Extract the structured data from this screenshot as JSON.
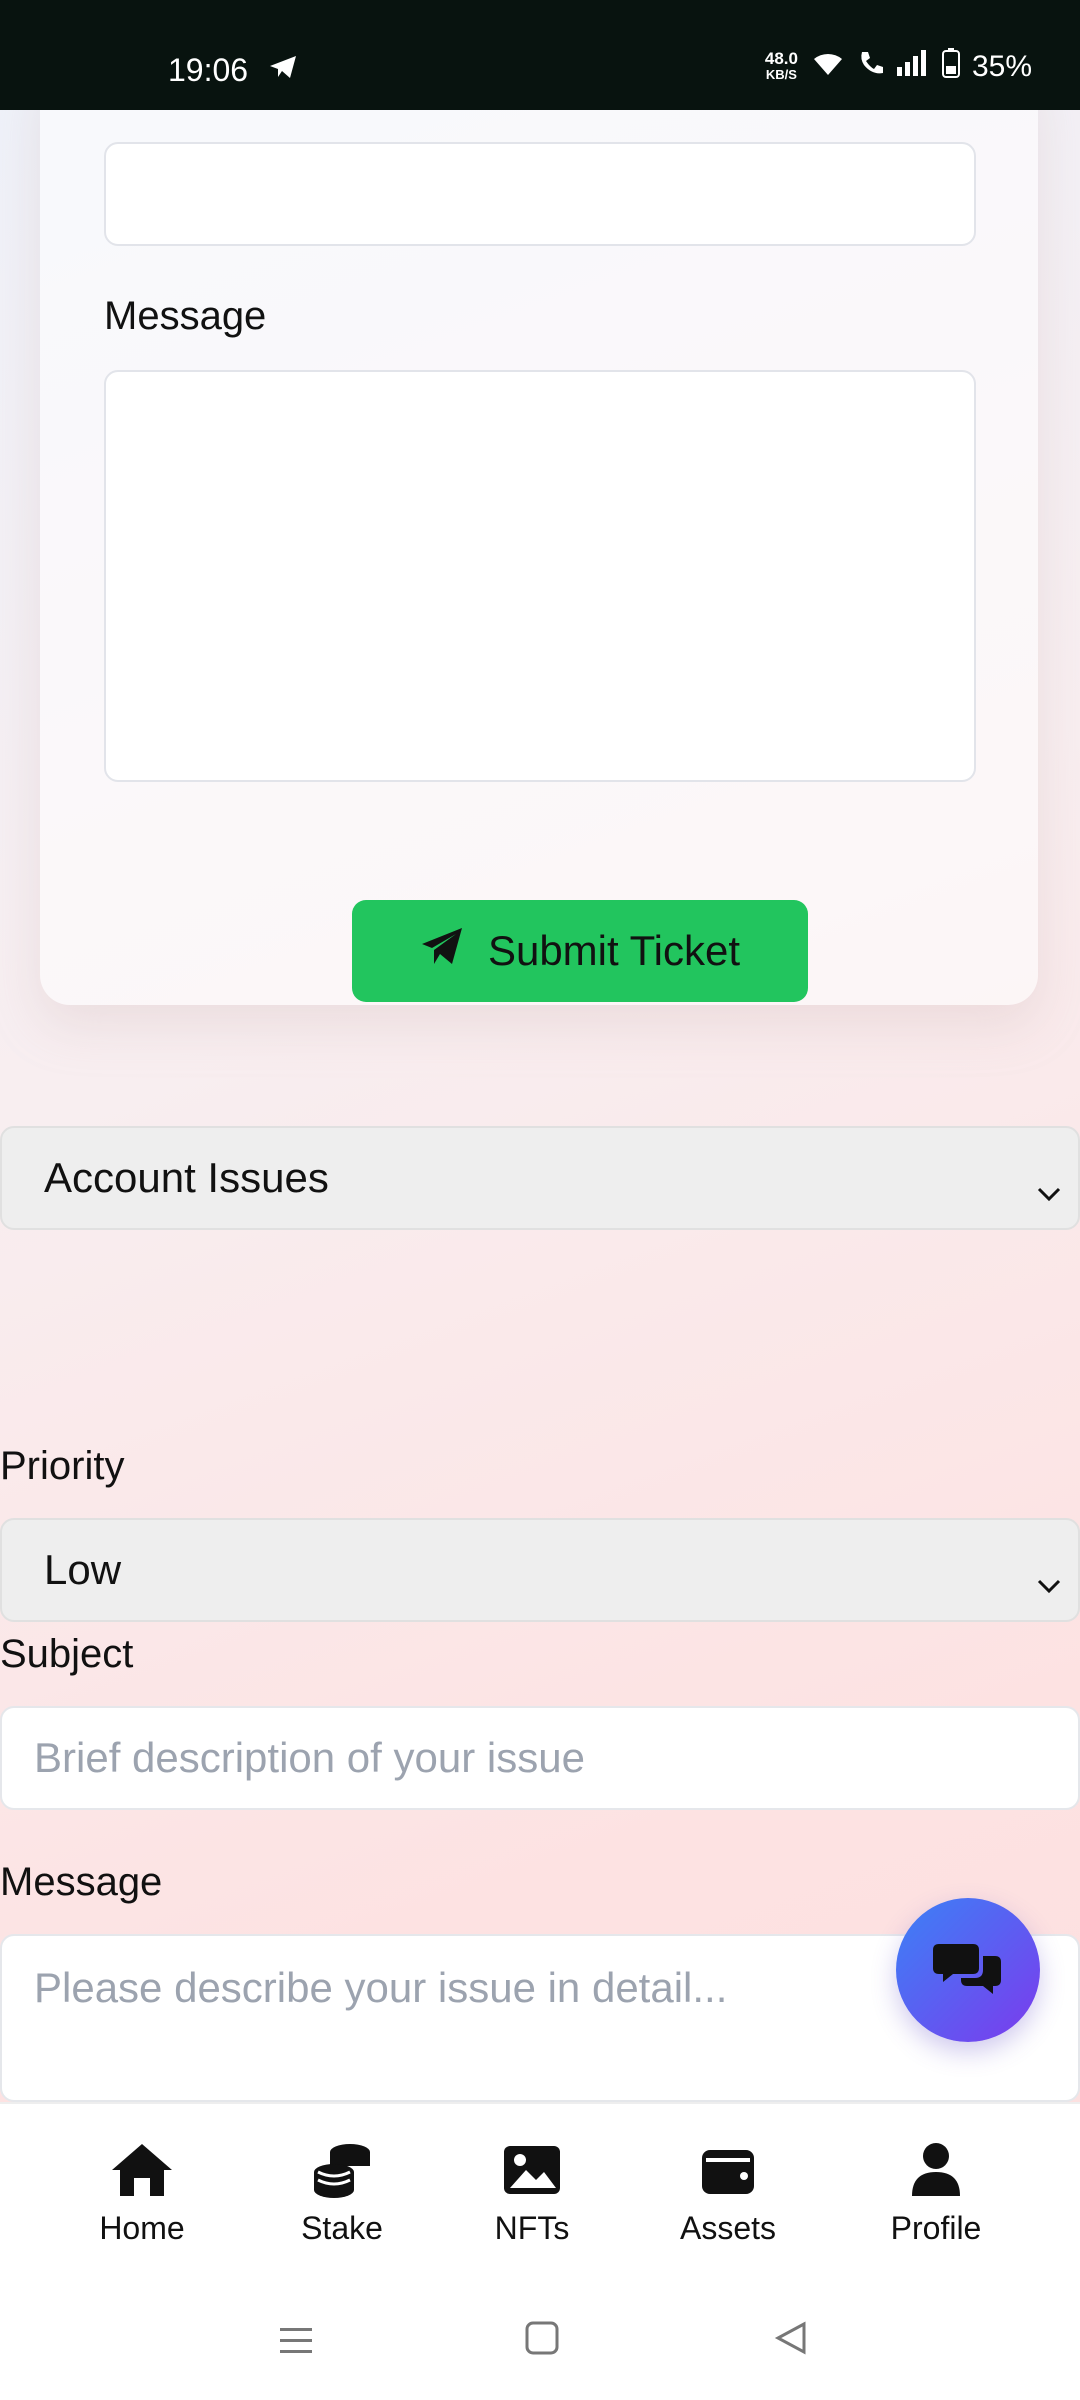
{
  "status_bar": {
    "time": "19:06",
    "speed_value": "48.0",
    "speed_unit": "KB/S",
    "battery": "35%"
  },
  "ticket_form": {
    "message_label": "Message",
    "submit_label": "Submit Ticket"
  },
  "category": {
    "selected": "Account Issues"
  },
  "priority": {
    "label": "Priority",
    "selected": "Low"
  },
  "subject": {
    "label": "Subject",
    "placeholder": "Brief description of your issue"
  },
  "message": {
    "label": "Message",
    "placeholder": "Please describe your issue in detail..."
  },
  "bottom_nav": {
    "items": [
      {
        "label": "Home",
        "icon": "home-icon"
      },
      {
        "label": "Stake",
        "icon": "coins-icon"
      },
      {
        "label": "NFTs",
        "icon": "image-icon"
      },
      {
        "label": "Assets",
        "icon": "wallet-icon"
      },
      {
        "label": "Profile",
        "icon": "user-icon"
      }
    ]
  },
  "colors": {
    "accent_green": "#22c55e",
    "fab_start": "#3b82f6",
    "fab_end": "#7c3aed"
  }
}
